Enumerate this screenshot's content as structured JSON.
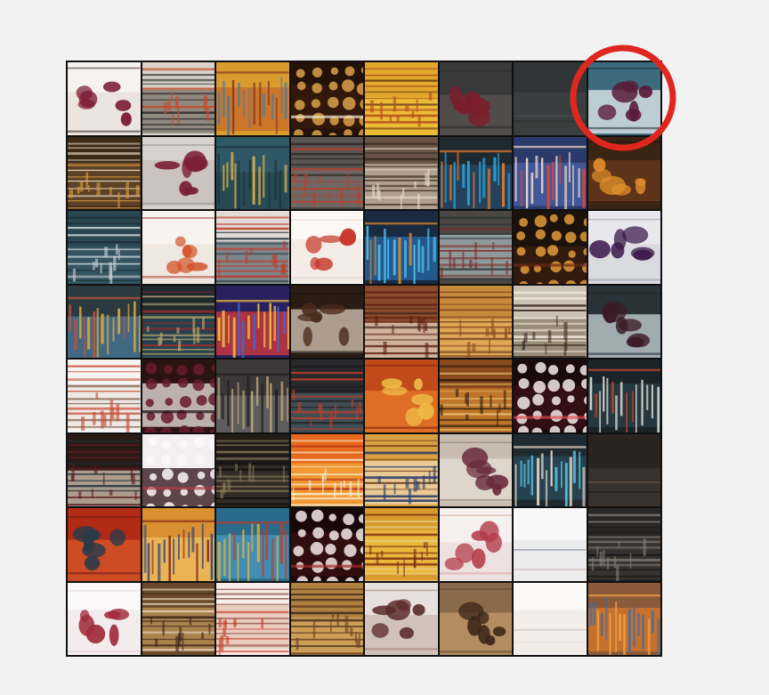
{
  "grid": {
    "rows": 8,
    "cols": 8,
    "tiles": [
      {
        "bg": "#f5f2ef",
        "base": "#e8e0da",
        "accent": "#7a1830",
        "band": "#3a2a2a",
        "pattern": "blobs"
      },
      {
        "bg": "#d8d2c8",
        "base": "#7a7068",
        "accent": "#c24b2b",
        "band": "#2c2a28",
        "pattern": "stripes"
      },
      {
        "bg": "#d99a2e",
        "base": "#c76a2a",
        "accent": "#4d7ea0",
        "band": "#8a3b1e",
        "pattern": "vstripes"
      },
      {
        "bg": "#241208",
        "base": "#3a1a0c",
        "accent": "#d9a24a",
        "band": "#f1e6c9",
        "pattern": "lattice"
      },
      {
        "bg": "#e0a72a",
        "base": "#f0c23a",
        "accent": "#b24a1d",
        "band": "#6b3a12",
        "pattern": "stripes"
      },
      {
        "bg": "#3a3a3a",
        "base": "#5a5350",
        "accent": "#7a1f2c",
        "band": "#2a2626",
        "pattern": "blobs"
      },
      {
        "bg": "#2f3534",
        "base": "#3c4341",
        "accent": "#4e5753",
        "band": "#262b2a",
        "pattern": "plain"
      },
      {
        "bg": "#3b6b7c",
        "base": "#e8eef2",
        "accent": "#5a1a3a",
        "band": "#26333a",
        "pattern": "blobs"
      },
      {
        "bg": "#3b2a18",
        "base": "#6a4a2a",
        "accent": "#e2a040",
        "band": "#efe3c9",
        "pattern": "stripes"
      },
      {
        "bg": "#d8d2cf",
        "base": "#c7beb7",
        "accent": "#7a1f33",
        "band": "#8d8a86",
        "pattern": "blobs"
      },
      {
        "bg": "#2f5866",
        "base": "#254550",
        "accent": "#e3b34a",
        "band": "#1d343c",
        "pattern": "vstripes"
      },
      {
        "bg": "#5a5553",
        "base": "#776e69",
        "accent": "#b93f2e",
        "band": "#2f2a28",
        "pattern": "stripes"
      },
      {
        "bg": "#6a5448",
        "base": "#c8b8a6",
        "accent": "#e6ddd0",
        "band": "#3a2c24",
        "pattern": "stripes"
      },
      {
        "bg": "#1f2a30",
        "base": "#2a4a6a",
        "accent": "#2aa9e0",
        "band": "#e87a2a",
        "pattern": "vstripes"
      },
      {
        "bg": "#2a3a6a",
        "base": "#4a62a8",
        "accent": "#e0443a",
        "band": "#f0d6c8",
        "pattern": "vstripes"
      },
      {
        "bg": "#3a2414",
        "base": "#6a3a1c",
        "accent": "#e2902a",
        "band": "#1e140c",
        "pattern": "blobs"
      },
      {
        "bg": "#2a4650",
        "base": "#375a66",
        "accent": "#cfd6d8",
        "band": "#1c2e34",
        "pattern": "stripes"
      },
      {
        "bg": "#f7f3ef",
        "base": "#ece4dc",
        "accent": "#d2542a",
        "band": "#a8352a",
        "pattern": "blobs"
      },
      {
        "bg": "#e2dcd8",
        "base": "#5a6a72",
        "accent": "#c23b2b",
        "band": "#2c3a40",
        "pattern": "stripes"
      },
      {
        "bg": "#fbf8f6",
        "base": "#f0e8e2",
        "accent": "#c73a2a",
        "band": "#e6d4c8",
        "pattern": "blobs"
      },
      {
        "bg": "#1a2a40",
        "base": "#2a6aa8",
        "accent": "#4fc3f0",
        "band": "#e08a2a",
        "pattern": "vstripes"
      },
      {
        "bg": "#4a4744",
        "base": "#a8b4b6",
        "accent": "#7a2a2a",
        "band": "#2a3234",
        "pattern": "stripes"
      },
      {
        "bg": "#1c120c",
        "base": "#3a1e10",
        "accent": "#e09a3a",
        "band": "#6a2a14",
        "pattern": "lattice"
      },
      {
        "bg": "#e8e8ec",
        "base": "#d6d6de",
        "accent": "#3a1a4a",
        "band": "#a0a0b0",
        "pattern": "blobs"
      },
      {
        "bg": "#2a3a40",
        "base": "#4a7a9a",
        "accent": "#e0a838",
        "band": "#c0523a",
        "pattern": "vstripes"
      },
      {
        "bg": "#1e2a2e",
        "base": "#2a4a58",
        "accent": "#c8b070",
        "band": "#a02a2a",
        "pattern": "stripes"
      },
      {
        "bg": "#2a2060",
        "base": "#d83a3a",
        "accent": "#3a6ad8",
        "band": "#f0c040",
        "pattern": "vstripes"
      },
      {
        "bg": "#2a1c14",
        "base": "#d8c8b8",
        "accent": "#4a2a1a",
        "band": "#1a120c",
        "pattern": "blobs"
      },
      {
        "bg": "#8a4a2a",
        "base": "#e8d6c2",
        "accent": "#5a1e14",
        "band": "#3a2418",
        "pattern": "stripes"
      },
      {
        "bg": "#c88a3a",
        "base": "#e8b060",
        "accent": "#8a4a1e",
        "band": "#6a3a18",
        "pattern": "stripes"
      },
      {
        "bg": "#ccc2b4",
        "base": "#8a7a68",
        "accent": "#3a2a22",
        "band": "#f0e8dc",
        "pattern": "stripes"
      },
      {
        "bg": "#2a3438",
        "base": "#c8d4d8",
        "accent": "#3a1a24",
        "band": "#1e2628",
        "pattern": "blobs"
      },
      {
        "bg": "#f6f4f2",
        "base": "#ece6e0",
        "accent": "#c4452a",
        "band": "#8a6a5a",
        "pattern": "stripes"
      },
      {
        "bg": "#2a1410",
        "base": "#efe6e2",
        "accent": "#6a1a2a",
        "band": "#1a0c0a",
        "pattern": "lattice"
      },
      {
        "bg": "#3a3838",
        "base": "#6a6a6a",
        "accent": "#c4a878",
        "band": "#222020",
        "pattern": "vstripes"
      },
      {
        "bg": "#2a2a2c",
        "base": "#4a5a62",
        "accent": "#c2402a",
        "band": "#1a1a1c",
        "pattern": "stripes"
      },
      {
        "bg": "#c04a1a",
        "base": "#e87a2a",
        "accent": "#f0c04a",
        "band": "#7a1e10",
        "pattern": "blobs"
      },
      {
        "bg": "#8a4a1e",
        "base": "#d0842e",
        "accent": "#2a1a10",
        "band": "#e8c070",
        "pattern": "stripes"
      },
      {
        "bg": "#1a0a0c",
        "base": "#3a1218",
        "accent": "#f2e8ea",
        "band": "#e04a4a",
        "pattern": "lattice"
      },
      {
        "bg": "#1a2428",
        "base": "#2a3e48",
        "accent": "#e6e2d8",
        "band": "#c44a2a",
        "pattern": "vstripes"
      },
      {
        "bg": "#2a1a14",
        "base": "#d8c8b6",
        "accent": "#5a1a24",
        "band": "#1e2e34",
        "pattern": "stripes"
      },
      {
        "bg": "#f4eef0",
        "base": "#2a0c14",
        "accent": "#fbf7f8",
        "band": "#b23a4a",
        "pattern": "lattice"
      },
      {
        "bg": "#221c18",
        "base": "#3a302a",
        "accent": "#8a7a5a",
        "band": "#141010",
        "pattern": "stripes"
      },
      {
        "bg": "#e86a1e",
        "base": "#f4a83a",
        "accent": "#f8f0d8",
        "band": "#b02a1a",
        "pattern": "stripes"
      },
      {
        "bg": "#d8a040",
        "base": "#efd8b0",
        "accent": "#2a3a6a",
        "band": "#6a3a1a",
        "pattern": "stripes"
      },
      {
        "bg": "#c8bcb0",
        "base": "#e6ddd4",
        "accent": "#6a2a3a",
        "band": "#8a7a6c",
        "pattern": "blobs"
      },
      {
        "bg": "#1e2a30",
        "base": "#2a4a5a",
        "accent": "#5ac0e0",
        "band": "#f0e0d0",
        "pattern": "vstripes"
      },
      {
        "bg": "#2a2420",
        "base": "#3e3630",
        "accent": "#8a7050",
        "band": "#1a1612",
        "pattern": "plain"
      },
      {
        "bg": "#b02a14",
        "base": "#d8582a",
        "accent": "#2a3a4a",
        "band": "#6a1a10",
        "pattern": "blobs"
      },
      {
        "bg": "#d89030",
        "base": "#f0c060",
        "accent": "#3a4a7a",
        "band": "#8a2a1a",
        "pattern": "vstripes"
      },
      {
        "bg": "#2a6a8a",
        "base": "#4a9ac0",
        "accent": "#e0b040",
        "band": "#c03a2a",
        "pattern": "vstripes"
      },
      {
        "bg": "#1a0808",
        "base": "#3a1010",
        "accent": "#f4e8e8",
        "band": "#a02a2a",
        "pattern": "lattice"
      },
      {
        "bg": "#d89a2a",
        "base": "#f0c040",
        "accent": "#7a2a14",
        "band": "#e8d090",
        "pattern": "stripes"
      },
      {
        "bg": "#f6f0ee",
        "base": "#e8dcd8",
        "accent": "#b23a4a",
        "band": "#d8a8a0",
        "pattern": "blobs"
      },
      {
        "bg": "#f8f8f8",
        "base": "#e8e8ea",
        "accent": "#5a6a80",
        "band": "#c8a8a0",
        "pattern": "plain"
      },
      {
        "bg": "#2a2826",
        "base": "#3a3634",
        "accent": "#8a8076",
        "band": "#1c1a18",
        "pattern": "stripes"
      },
      {
        "bg": "#faf8f8",
        "base": "#f0e8ea",
        "accent": "#a02a3a",
        "band": "#e0d0d4",
        "pattern": "blobs"
      },
      {
        "bg": "#6a4a2a",
        "base": "#c0965a",
        "accent": "#3a2418",
        "band": "#e8d8c0",
        "pattern": "stripes"
      },
      {
        "bg": "#f6eeea",
        "base": "#e6c0b0",
        "accent": "#c83a2a",
        "band": "#8a4a3a",
        "pattern": "stripes"
      },
      {
        "bg": "#b08040",
        "base": "#d8a860",
        "accent": "#6a4020",
        "band": "#3a2414",
        "pattern": "stripes"
      },
      {
        "bg": "#e8e0dc",
        "base": "#c8b8b0",
        "accent": "#5a2a2a",
        "band": "#a08070",
        "pattern": "blobs"
      },
      {
        "bg": "#8a6a4a",
        "base": "#c09a6a",
        "accent": "#3a2418",
        "band": "#5a4030",
        "pattern": "blobs"
      },
      {
        "bg": "#fbf9f8",
        "base": "#f0e8e6",
        "accent": "#c0a8a8",
        "band": "#e8dcd8",
        "pattern": "plain"
      },
      {
        "bg": "#8a5a3a",
        "base": "#d87a2a",
        "accent": "#4a6a9a",
        "band": "#f0a040",
        "pattern": "vstripes"
      }
    ]
  },
  "highlight": {
    "row": 0,
    "col": 7,
    "color": "#e0271f"
  }
}
